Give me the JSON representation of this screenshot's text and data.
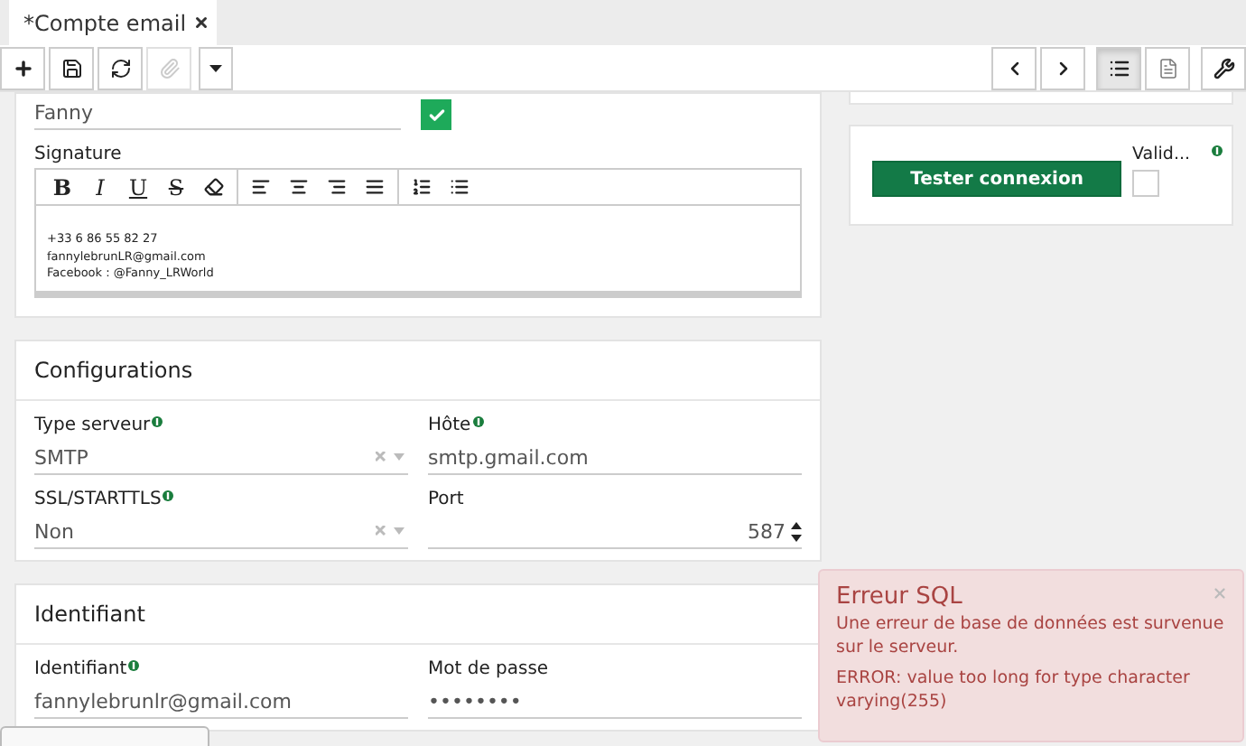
{
  "tab": {
    "title": "*Compte email"
  },
  "toolbar_left": [
    {
      "kind": "add",
      "disabled": false
    },
    {
      "kind": "save",
      "disabled": false
    },
    {
      "kind": "refresh",
      "disabled": false
    },
    {
      "kind": "attach",
      "disabled": true
    },
    {
      "kind": "menu",
      "disabled": false
    }
  ],
  "toolbar_right": [
    {
      "kind": "previous",
      "selected": false
    },
    {
      "kind": "next",
      "selected": false
    },
    {
      "kind": "list",
      "selected": true
    },
    {
      "kind": "document",
      "selected": false
    },
    {
      "kind": "settings",
      "selected": false
    }
  ],
  "name_field": {
    "value": "Fanny",
    "checked": true
  },
  "signature": {
    "label": "Signature",
    "tools": [
      {
        "kind": "bold",
        "label": "B"
      },
      {
        "kind": "italic",
        "label": "I"
      },
      {
        "kind": "underline",
        "label": "U"
      },
      {
        "kind": "strike",
        "label": "S"
      },
      {
        "kind": "eraser"
      },
      {
        "kind": "align-left"
      },
      {
        "kind": "align-center"
      },
      {
        "kind": "align-right"
      },
      {
        "kind": "justify"
      },
      {
        "kind": "ordered-list"
      },
      {
        "kind": "bullet-list"
      }
    ],
    "lines": [
      "+33 6 86 55 82 27",
      "fannylebrunLR@gmail.com",
      "Facebook : @Fanny_LRWorld"
    ]
  },
  "test_panel": {
    "button": "Tester connexion",
    "valid_label": "Valid...",
    "valid_checked": false
  },
  "sections": [
    {
      "title": "Configurations",
      "fields": [
        {
          "label": "Type serveur",
          "info": true,
          "kind": "select",
          "value": "SMTP"
        },
        {
          "label": "Hôte",
          "info": true,
          "kind": "text",
          "value": "smtp.gmail.com"
        },
        {
          "label": "SSL/STARTTLS",
          "info": true,
          "kind": "select",
          "value": "Non"
        },
        {
          "label": "Port",
          "info": false,
          "kind": "number",
          "value": "587"
        }
      ]
    },
    {
      "title": "Identifiant",
      "fields": [
        {
          "label": "Identifiant",
          "info": true,
          "kind": "text",
          "value": "fannylebrunlr@gmail.com"
        },
        {
          "label": "Mot de passe",
          "info": false,
          "kind": "password",
          "value": "••••••••"
        }
      ]
    }
  ],
  "toast": {
    "title": "Erreur SQL",
    "message": "Une erreur de base de données est survenue sur le serveur.",
    "detail": "ERROR: value too long for type character varying(255)"
  }
}
